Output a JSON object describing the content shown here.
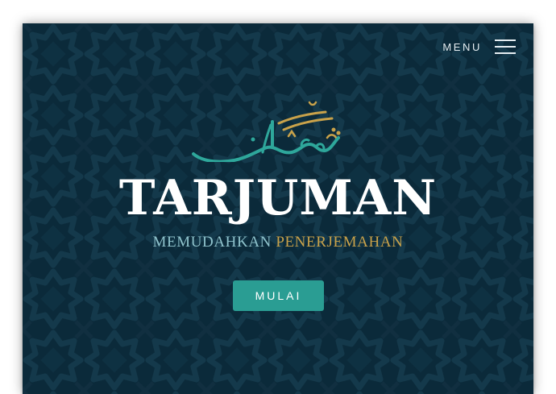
{
  "header": {
    "menu_label": "MENU"
  },
  "hero": {
    "logo_arabic": "ترجمان",
    "title": "TARJUMAN",
    "subtitle_part1": "MEMUDAHKAN ",
    "subtitle_part2": "PENERJEMAHAN",
    "cta_label": "MULAI"
  },
  "colors": {
    "background": "#0b2a3a",
    "accent_teal": "#2a9d93",
    "accent_gold": "#c9a24a",
    "subtitle_teal": "#8fc3cc",
    "text_white": "#ffffff"
  },
  "icons": {
    "menu": "hamburger-menu-icon"
  }
}
